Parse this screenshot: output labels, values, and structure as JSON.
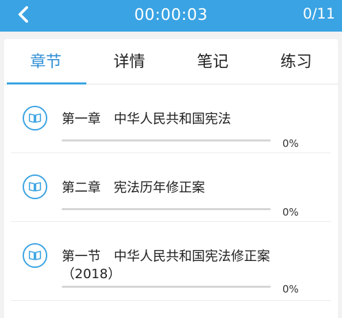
{
  "header": {
    "timer": "00:00:03",
    "counter": "0/11",
    "back_icon": "chevron-left-icon"
  },
  "tabs": [
    {
      "label": "章节",
      "active": true
    },
    {
      "label": "详情",
      "active": false
    },
    {
      "label": "笔记",
      "active": false
    },
    {
      "label": "练习",
      "active": false
    }
  ],
  "chapters": [
    {
      "title": "第一章　中华人民共和国宪法",
      "progress": "0%",
      "progress_value": 0,
      "icon": "book-icon"
    },
    {
      "title": "第二章　宪法历年修正案",
      "progress": "0%",
      "progress_value": 0,
      "icon": "book-icon"
    },
    {
      "title": "第一节　中华人民共和国宪法修正案（2018）",
      "progress": "0%",
      "progress_value": 0,
      "icon": "book-icon"
    }
  ],
  "colors": {
    "accent": "#3aa3e3",
    "tab_active": "#2f8fd6",
    "text": "#222222",
    "background": "#f2f2f2"
  }
}
